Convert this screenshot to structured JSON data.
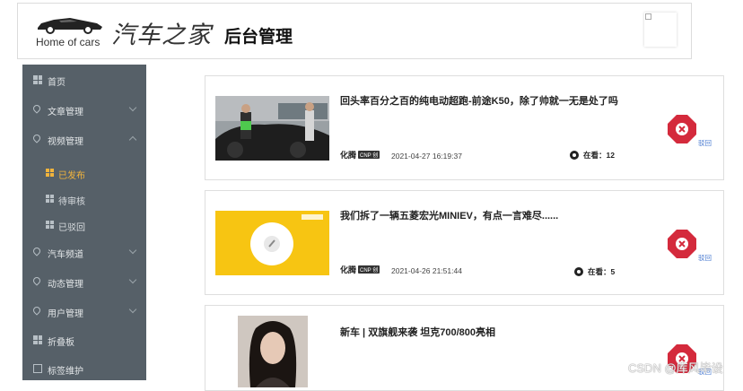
{
  "header": {
    "logo_en": "Home of cars",
    "logo_zh": "汽车之家",
    "title": "后台管理"
  },
  "sidebar": {
    "items": [
      {
        "label": "首页",
        "icon": "grid-icon"
      },
      {
        "label": "文章管理",
        "icon": "pin-icon"
      },
      {
        "label": "视频管理",
        "icon": "pin-icon"
      },
      {
        "label": "已发布",
        "icon": "grid-icon",
        "active": true
      },
      {
        "label": "待审核",
        "icon": "grid-icon"
      },
      {
        "label": "已驳回",
        "icon": "grid-icon"
      },
      {
        "label": "汽车频道",
        "icon": "pin-icon"
      },
      {
        "label": "动态管理",
        "icon": "pin-icon"
      },
      {
        "label": "用户管理",
        "icon": "pin-icon"
      },
      {
        "label": "折叠板",
        "icon": "grid-icon"
      },
      {
        "label": "标签维护",
        "icon": "book-icon"
      }
    ],
    "active_color": "#f2b43c",
    "bg_color": "#566068"
  },
  "posts": [
    {
      "title": "回头率百分之百的纯电动超跑-前途K50，除了帅就一无是处了吗",
      "author": "化腾",
      "badge": "CNP 创",
      "date": "2021-04-27 16:19:37",
      "views_label": "在看：",
      "views": "12",
      "reject_label": "驳回"
    },
    {
      "title": "我们拆了一辆五菱宏光MINIEV，有点一言难尽......",
      "author": "化腾",
      "badge": "CNP 创",
      "date": "2021-04-26 21:51:44",
      "views_label": "在看：",
      "views": "5",
      "reject_label": "驳回"
    },
    {
      "title": "新车 | 双旗舰来袭 坦克700/800亮相",
      "reject_label": "驳回"
    }
  ],
  "delete_color": "#d42a3c",
  "watermark": "CSDN @库风毕设"
}
